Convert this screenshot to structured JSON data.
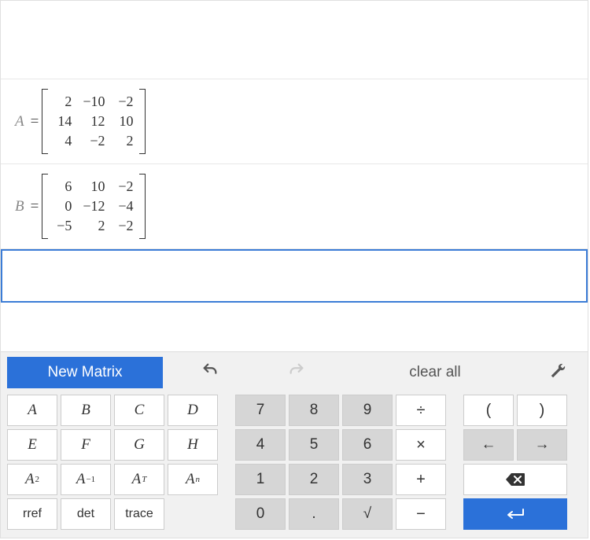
{
  "matrices": {
    "A": {
      "label": "A",
      "rows": [
        [
          "2",
          "−10",
          "−2"
        ],
        [
          "14",
          "12",
          "10"
        ],
        [
          "4",
          "−2",
          "2"
        ]
      ]
    },
    "B": {
      "label": "B",
      "rows": [
        [
          "6",
          "10",
          "−2"
        ],
        [
          "0",
          "−12",
          "−4"
        ],
        [
          "−5",
          "2",
          "−2"
        ]
      ]
    }
  },
  "toolbar": {
    "new_matrix": "New Matrix",
    "clear_all": "clear all"
  },
  "keys": {
    "left": {
      "r1": [
        "A",
        "B",
        "C",
        "D"
      ],
      "r2": [
        "E",
        "F",
        "G",
        "H"
      ],
      "sq": "A",
      "sq_sup": "2",
      "inv": "A",
      "inv_sup": "−1",
      "tr": "A",
      "tr_sup": "T",
      "pow": "A",
      "pow_sup": "n",
      "rref": "rref",
      "det": "det",
      "trace": "trace"
    },
    "mid": {
      "n7": "7",
      "n8": "8",
      "n9": "9",
      "div": "÷",
      "n4": "4",
      "n5": "5",
      "n6": "6",
      "mul": "×",
      "n1": "1",
      "n2": "2",
      "n3": "3",
      "add": "+",
      "n0": "0",
      "dot": ".",
      "sqrt": "√",
      "sub": "−"
    },
    "right": {
      "lp": "(",
      "rp": ")",
      "left": "←",
      "right": "→",
      "enter": "↵"
    }
  }
}
